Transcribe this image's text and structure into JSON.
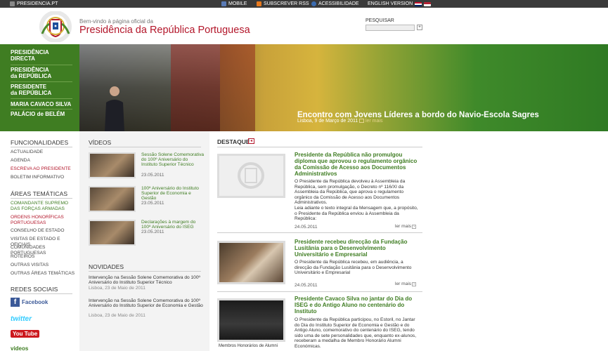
{
  "topbar": {
    "site": "PRESIDENCIA.PT",
    "mobile": "MOBILE",
    "rss": "SUBSCREVER RSS",
    "accessibility": "ACESSIBILIDADE",
    "english": "ENGLISH VERSION"
  },
  "header": {
    "welcome": "Bem-vindo à página oficial da",
    "title": "Presidência da República Portuguesa",
    "search_label": "PESQUISAR",
    "search_button": "+"
  },
  "nav": [
    {
      "label_l1": "PRESIDÊNCIA",
      "label_l2": "DIRECTA"
    },
    {
      "label_l1": "PRESIDÊNCIA",
      "label_l2": "da REPÚBLICA"
    },
    {
      "label_l1": "PRESIDENTE",
      "label_l2": "da REPÚBLICA"
    },
    {
      "label_l1": "MARIA CAVACO SILVA",
      "label_l2": ""
    },
    {
      "label_l1": "PALÁCIO de BELÉM",
      "label_l2": ""
    }
  ],
  "hero": {
    "title": "Encontro com Jovens Líderes a bordo do Navio-Escola Sagres",
    "date": "Lisboa, 9 de Março de 2011",
    "more": "ler mais"
  },
  "left": {
    "funcionalidades_title": "FUNCIONALIDADES",
    "funcionalidades": [
      "ACTUALIDADE",
      "AGENDA",
      "ESCREVA AO PRESIDENTE",
      "BOLETIM INFORMATIVO"
    ],
    "areas_title": "ÁREAS TEMÁTICAS",
    "areas": [
      {
        "l1": "COMANDANTE SUPREMO",
        "l2": "DAS FORÇAS ARMADAS"
      },
      {
        "l1": "ORDENS HONORÍFICAS",
        "l2": "PORTUGUESAS"
      },
      {
        "l1": "CONSELHO DE ESTADO",
        "l2": ""
      },
      {
        "l1": "VISITAS DE ESTADO E OFICIAIS",
        "l2": ""
      },
      {
        "l1": "COMUNIDADES PORTUGUESAS",
        "l2": ""
      },
      {
        "l1": "ROTEIROS",
        "l2": ""
      },
      {
        "l1": "OUTRAS VISITAS",
        "l2": ""
      },
      {
        "l1": "OUTRAS ÁREAS TEMÁTICAS",
        "l2": ""
      }
    ],
    "social_title": "REDES SOCIAIS",
    "facebook": "Facebook",
    "twitter": "twitter",
    "youtube": "You Tube",
    "videos": "videos"
  },
  "videos": {
    "title": "VÍDEOS",
    "items": [
      {
        "title": "Sessão Solene Comemorativa do 100º Aniversário do Instituto Superior Técnico",
        "date": "23.05.2011"
      },
      {
        "title": "100º Aniversário do Instituto Superior de Economia e Gestão",
        "date": "23.05.2011"
      },
      {
        "title": "Declarações à margem do 100º Aniversário do ISEG",
        "date": "23.05.2011"
      }
    ]
  },
  "novidades": {
    "title": "NOVIDADES",
    "items": [
      {
        "title": "Intervenção na Sessão Solene Comemorativa do 100º Aniversário do Instituto Superior Técnico",
        "date": "Lisboa, 23 de Maio de 2011"
      },
      {
        "title": "Intervenção na Sessão Solene Comemorativa do 100º Aniversário do Instituto Superior de Economia e Gestão",
        "date": "Lisboa, 23 de Maio de 2011"
      }
    ]
  },
  "destaque": {
    "title": "DESTAQUE",
    "more": "ler mais",
    "articles": [
      {
        "title": "Presidente da República não promulgou diploma que aprovou o regulamento orgânico da Comissão de Acesso aos Documentos Administrativos",
        "body1": "O Presidente da República devolveu à Assembleia da República, sem promulgação, o Decreto nº 116/XI da Assembleia da República, que aprova o regulamento orgânico da Comissão de Acesso aos Documentos Administrativos.",
        "body2": "Leia adiante o texto integral da Mensagem que, a propósito, o Presidente da República enviou à Assembleia da República:",
        "date": "24.05.2011"
      },
      {
        "title": "Presidente recebeu direcção da Fundação Lusitânia para o Desenvolvimento Universitário e Empresarial",
        "body1": "O Presidente da República recebeu, em audiência, a direcção da Fundação Lusitânia para o Desenvolvimento Universitário e Empresarial",
        "body2": "",
        "date": "24.05.2011"
      },
      {
        "title": "Presidente Cavaco Silva no jantar do Dia do ISEG e do Antigo Aluno no centenário do Instituto",
        "body1": "O Presidente da República participou, no Estoril, no Jantar do Dia do Instituto Superior de Economia e Gestão e do Antigo Aluno, comemorativo do centenário do ISEG, tendo sido uma de sete personalidades que, enquanto ex-alunos, receberam a medalha de Membro Honorário Alumni Económicas.",
        "body2": "",
        "date": "",
        "caption": "Membros Honorários de Alumni"
      }
    ]
  },
  "colors": {
    "brand_red": "#b3162a",
    "brand_green": "#3f7d22"
  }
}
